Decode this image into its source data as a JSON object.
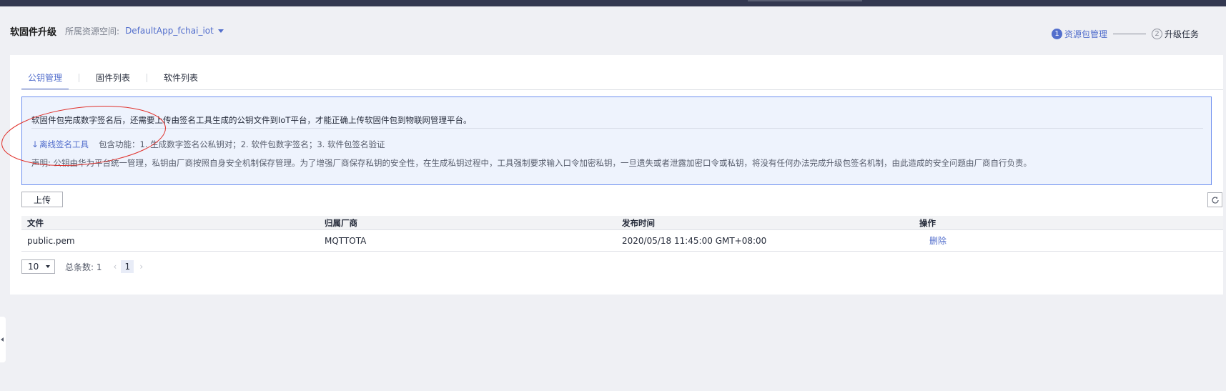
{
  "header": {
    "title": "软固件升级",
    "resource_space_label": "所属资源空间:",
    "resource_space_value": "DefaultApp_fchai_iot"
  },
  "steps": [
    {
      "number": "1",
      "label": "资源包管理",
      "active": true
    },
    {
      "number": "2",
      "label": "升级任务",
      "active": false
    }
  ],
  "tabs": [
    {
      "label": "公钥管理",
      "active": true
    },
    {
      "label": "固件列表",
      "active": false
    },
    {
      "label": "软件列表",
      "active": false
    }
  ],
  "notice": {
    "line1": "软固件包完成数字签名后，还需要上传由签名工具生成的公钥文件到IoT平台，才能正确上传软固件包到物联网管理平台。",
    "tool_link": "离线签名工具",
    "features": "包含功能：1. 生成数字签名公私钥对；2. 软件包数字签名；3. 软件包签名验证",
    "disclaimer": "声明: 公钥由华为平台统一管理，私钥由厂商按照自身安全机制保存管理。为了增强厂商保存私钥的安全性，在生成私钥过程中，工具强制要求输入口令加密私钥，一旦遗失或者泄露加密口令或私钥，将没有任何办法完成升级包签名机制，由此造成的安全问题由厂商自行负责。"
  },
  "toolbar": {
    "upload_label": "上传"
  },
  "table": {
    "columns": [
      "文件",
      "归属厂商",
      "发布时间",
      "操作"
    ],
    "rows": [
      {
        "file": "public.pem",
        "vendor": "MQTTOTA",
        "time": "2020/05/18 11:45:00 GMT+08:00",
        "action": "删除"
      }
    ]
  },
  "pagination": {
    "page_size": "10",
    "total": "总条数: 1",
    "current_page": "1"
  },
  "icons": {
    "dropdown": "caret-down-icon",
    "download": "download-icon",
    "refresh": "refresh-icon",
    "prev": "chevron-left-icon",
    "next": "chevron-right-icon",
    "collapse": "collapse-handle-icon"
  },
  "colors": {
    "accent": "#526ecc",
    "topbar": "#333850",
    "page_bg": "#eff0f4",
    "notice_bg": "#eef3fd",
    "notice_border": "#6d8ff0",
    "annotation": "#e0302a"
  }
}
